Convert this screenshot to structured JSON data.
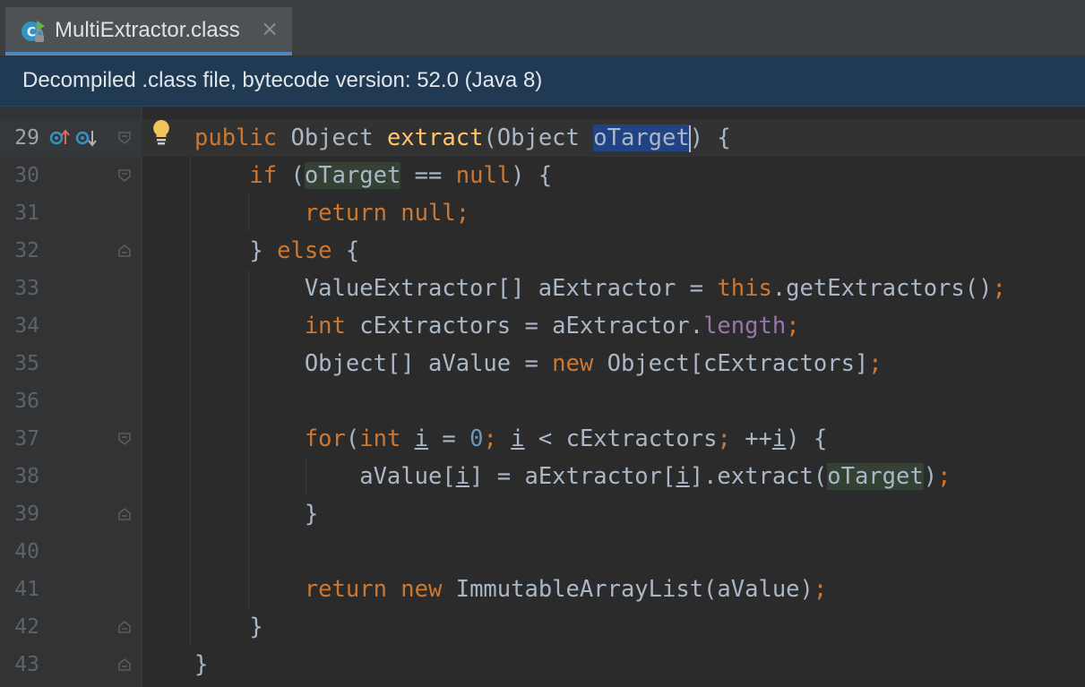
{
  "tab": {
    "title": "MultiExtractor.class",
    "close_glyph": "×",
    "icon": "class-file-icon"
  },
  "banner": {
    "text": "Decompiled .class file, bytecode version: 52.0 (Java 8)"
  },
  "editor": {
    "partial_top_line": "28",
    "gutter_icons": [
      "implements-icon",
      "overrides-icon"
    ],
    "intention_icon": "lightbulb-icon",
    "lines": [
      {
        "n": "29",
        "tokens": [
          [
            "public",
            "kw"
          ],
          [
            " Object ",
            ""
          ],
          [
            "extract",
            "fn"
          ],
          [
            "(Object ",
            ""
          ],
          [
            "oTarget",
            "sel-caret"
          ],
          [
            ") {",
            ""
          ]
        ]
      },
      {
        "n": "30",
        "tokens": [
          [
            "    ",
            ""
          ],
          [
            "if",
            "kw"
          ],
          [
            " (",
            ""
          ],
          [
            "oTarget",
            "ref"
          ],
          [
            " == ",
            ""
          ],
          [
            "null",
            "kw"
          ],
          [
            ") {",
            ""
          ]
        ]
      },
      {
        "n": "31",
        "tokens": [
          [
            "        ",
            ""
          ],
          [
            "return null;",
            "kw"
          ]
        ]
      },
      {
        "n": "32",
        "tokens": [
          [
            "    } ",
            ""
          ],
          [
            "else",
            "kw"
          ],
          [
            " {",
            ""
          ]
        ]
      },
      {
        "n": "33",
        "tokens": [
          [
            "        ValueExtractor[] aExtractor = ",
            ""
          ],
          [
            "this",
            "kw"
          ],
          [
            ".getExtractors()",
            ""
          ],
          [
            ";",
            "kw"
          ]
        ]
      },
      {
        "n": "34",
        "tokens": [
          [
            "        ",
            ""
          ],
          [
            "int",
            "kw"
          ],
          [
            " cExtractors = aExtractor.",
            ""
          ],
          [
            "length",
            "fld"
          ],
          [
            ";",
            "kw"
          ]
        ]
      },
      {
        "n": "35",
        "tokens": [
          [
            "        Object[] aValue = ",
            ""
          ],
          [
            "new",
            "kw"
          ],
          [
            " Object[cExtractors]",
            ""
          ],
          [
            ";",
            "kw"
          ]
        ]
      },
      {
        "n": "36",
        "tokens": []
      },
      {
        "n": "37",
        "tokens": [
          [
            "        ",
            ""
          ],
          [
            "for",
            "kw"
          ],
          [
            "(",
            ""
          ],
          [
            "int",
            "kw"
          ],
          [
            " ",
            ""
          ],
          [
            "i",
            "ul"
          ],
          [
            " = ",
            ""
          ],
          [
            "0",
            "num"
          ],
          [
            "; ",
            "kw"
          ],
          [
            "i",
            "ul"
          ],
          [
            " < cExtractors",
            ""
          ],
          [
            "; ",
            "kw"
          ],
          [
            "++",
            ""
          ],
          [
            "i",
            "ul"
          ],
          [
            ") {",
            ""
          ]
        ]
      },
      {
        "n": "38",
        "tokens": [
          [
            "            aValue[",
            ""
          ],
          [
            "i",
            "ul"
          ],
          [
            "] = aExtractor[",
            ""
          ],
          [
            "i",
            "ul"
          ],
          [
            "].extract(",
            ""
          ],
          [
            "oTarget",
            "ref"
          ],
          [
            ")",
            ""
          ],
          [
            ";",
            "kw"
          ]
        ]
      },
      {
        "n": "39",
        "tokens": [
          [
            "        }",
            ""
          ]
        ]
      },
      {
        "n": "40",
        "tokens": []
      },
      {
        "n": "41",
        "tokens": [
          [
            "        ",
            ""
          ],
          [
            "return new",
            "kw"
          ],
          [
            " ImmutableArrayList(aValue)",
            ""
          ],
          [
            ";",
            "kw"
          ]
        ]
      },
      {
        "n": "42",
        "tokens": [
          [
            "    }",
            ""
          ]
        ]
      },
      {
        "n": "43",
        "tokens": [
          [
            "}",
            ""
          ]
        ]
      }
    ]
  },
  "colors": {
    "keyword": "#cc7832",
    "method": "#ffc66d",
    "number": "#6897bb",
    "field": "#9876aa",
    "text": "#a9b7c6",
    "selection": "#214283",
    "usage_highlight": "#344134",
    "banner_bg": "#1f3a52",
    "tab_underline": "#4a88c7"
  }
}
